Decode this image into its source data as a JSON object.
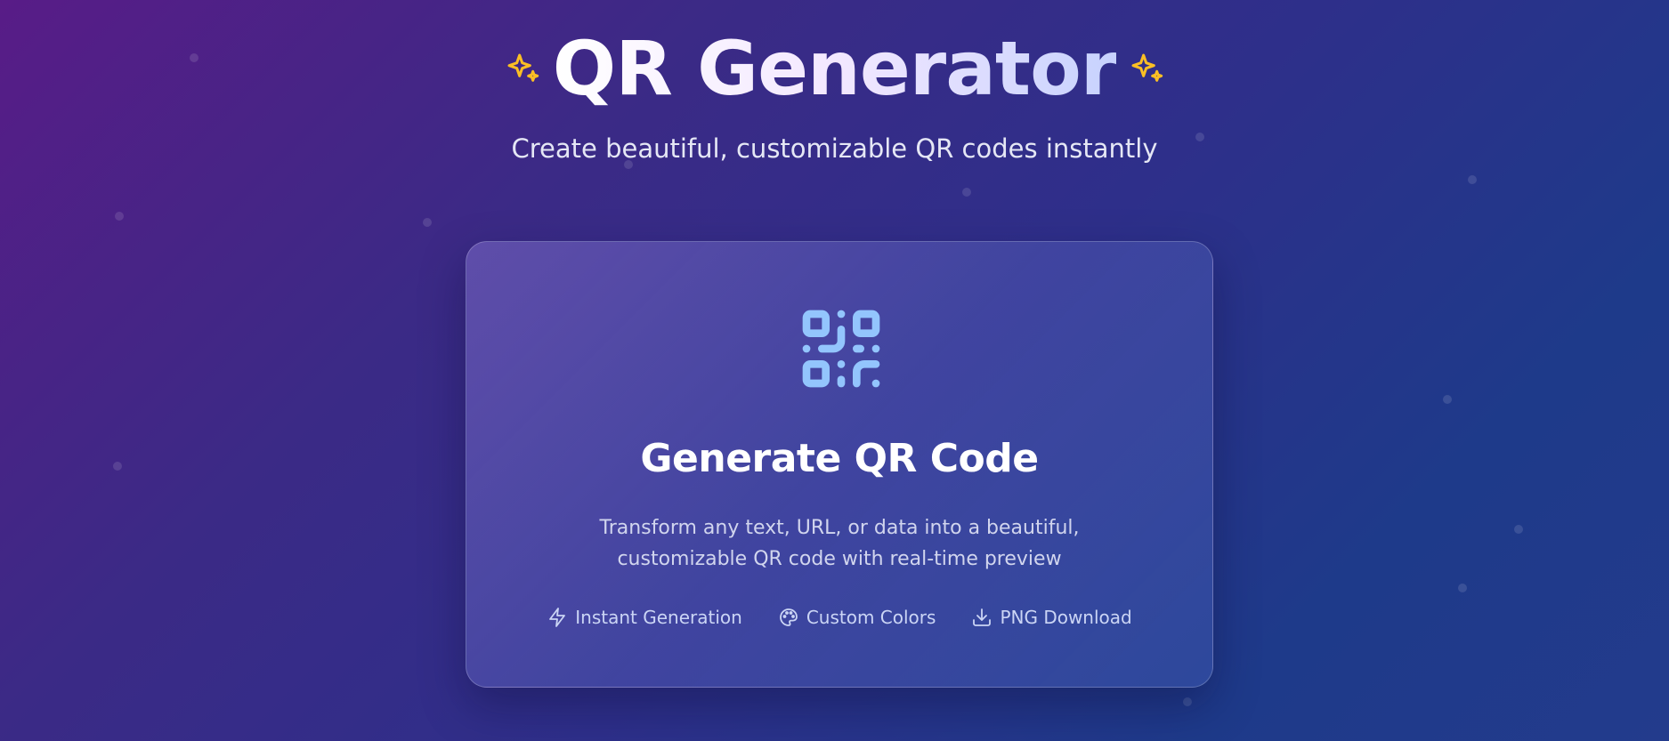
{
  "header": {
    "title": "QR Generator",
    "subtitle": "Create beautiful, customizable QR codes instantly",
    "sparkle_icon": "sparkles-icon"
  },
  "card": {
    "icon": "qr-code-icon",
    "title": "Generate QR Code",
    "description_line1": "Transform any text, URL, or data into a beautiful,",
    "description_line2": "customizable QR code with real-time preview",
    "features": [
      {
        "label": "Instant Generation",
        "icon": "zap-icon"
      },
      {
        "label": "Custom Colors",
        "icon": "palette-icon"
      },
      {
        "label": "PNG Download",
        "icon": "download-icon"
      }
    ]
  },
  "colors": {
    "background_start": "#581c87",
    "background_end": "#1e3a8a",
    "sparkle": "#fbbf24",
    "qr_icon": "#93c5fd"
  }
}
